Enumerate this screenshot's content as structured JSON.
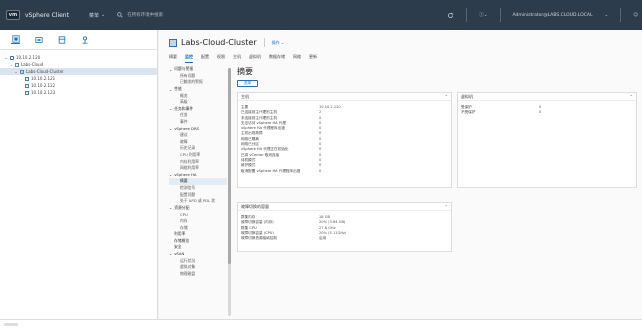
{
  "header": {
    "logo_text": "vm",
    "product_name": "vSphere Client",
    "menu_label": "菜单",
    "search_placeholder": "在所有环境中搜索",
    "user_label": "Administrator@LABS.CLOUD.LOCAL"
  },
  "left_panel": {
    "tree": [
      {
        "label": "10.10.2.120",
        "depth": 0,
        "toggle": "⌄",
        "icon": "vcenter-icon"
      },
      {
        "label": "Labs-Cloud",
        "depth": 1,
        "toggle": "⌄",
        "icon": "datacenter-icon"
      },
      {
        "label": "Labs-Cloud-Cluster",
        "depth": 2,
        "toggle": "⌄",
        "icon": "cluster-icon",
        "selected": true
      },
      {
        "label": "10.10.2.121",
        "depth": 3,
        "toggle": "",
        "icon": "host-icon"
      },
      {
        "label": "10.10.2.122",
        "depth": 3,
        "toggle": "",
        "icon": "host-icon"
      },
      {
        "label": "10.10.2.123",
        "depth": 3,
        "toggle": "",
        "icon": "host-icon"
      }
    ]
  },
  "content": {
    "title": "Labs-Cloud-Cluster",
    "actions_label": "操作 ⌄",
    "tabs": [
      "摘要",
      "监控",
      "配置",
      "权限",
      "主机",
      "虚拟机",
      "数据存储",
      "网络",
      "更新"
    ],
    "active_tab": 1
  },
  "subnav": [
    {
      "label": "问题与警报",
      "type": "group"
    },
    {
      "label": "所有问题",
      "type": "child"
    },
    {
      "label": "已触发的警报",
      "type": "child"
    },
    {
      "label": "性能",
      "type": "group"
    },
    {
      "label": "概览",
      "type": "child"
    },
    {
      "label": "高级",
      "type": "child"
    },
    {
      "label": "任务和事件",
      "type": "group"
    },
    {
      "label": "任务",
      "type": "child"
    },
    {
      "label": "事件",
      "type": "child"
    },
    {
      "label": "vSphere DRS",
      "type": "group"
    },
    {
      "label": "建议",
      "type": "child"
    },
    {
      "label": "故障",
      "type": "child"
    },
    {
      "label": "历史记录",
      "type": "child"
    },
    {
      "label": "CPU 利用率",
      "type": "child"
    },
    {
      "label": "内存利用率",
      "type": "child"
    },
    {
      "label": "网络利用率",
      "type": "child"
    },
    {
      "label": "vSphere HA",
      "type": "group"
    },
    {
      "label": "摘要",
      "type": "child",
      "active": true
    },
    {
      "label": "检测信号",
      "type": "child"
    },
    {
      "label": "配置问题",
      "type": "child"
    },
    {
      "label": "处于 APD 或 PDL 状",
      "type": "child"
    },
    {
      "label": "资源分配",
      "type": "group"
    },
    {
      "label": "CPU",
      "type": "child"
    },
    {
      "label": "内存",
      "type": "child"
    },
    {
      "label": "存储",
      "type": "child"
    },
    {
      "label": "利用率",
      "type": "flat"
    },
    {
      "label": "存储概览",
      "type": "flat"
    },
    {
      "label": "安全",
      "type": "flat"
    },
    {
      "label": "vSAN",
      "type": "group"
    },
    {
      "label": "运行状况",
      "type": "child"
    },
    {
      "label": "虚拟对象",
      "type": "child"
    },
    {
      "label": "物理磁盘",
      "type": "child"
    }
  ],
  "main": {
    "page_title": "摘要",
    "new_button": "选择",
    "hosts_card": {
      "title": "主机",
      "rows": [
        {
          "k": "主要",
          "v": "10.10.2.120"
        },
        {
          "k": "已连接到主代理的主机",
          "v": "2"
        },
        {
          "k": "未连接到主代理的主机",
          "v": "0"
        },
        {
          "k": "无法访问 vSphere HA 代理",
          "v": "0"
        },
        {
          "k": "vSphere HA 代理程序出错",
          "v": "0"
        },
        {
          "k": "主机出现故障",
          "v": "0"
        },
        {
          "k": "网络已隔离",
          "v": "0"
        },
        {
          "k": "网络已分区",
          "v": "0"
        },
        {
          "k": "vSphere HA 代理正在初始化",
          "v": "0"
        },
        {
          "k": "已将 vCenter 取消连接",
          "v": "0"
        },
        {
          "k": "待机模式",
          "v": "0"
        },
        {
          "k": "维护模式",
          "v": "0"
        },
        {
          "k": "取消配置 vSphere HA 代理程序出错",
          "v": "0"
        }
      ]
    },
    "vms_card": {
      "title": "虚拟机",
      "rows": [
        {
          "k": "受保护",
          "v": "0"
        },
        {
          "k": "不受保护",
          "v": "0"
        }
      ]
    },
    "reserve_card": {
      "title": "故障切换的容量",
      "rows": [
        {
          "k": "群集内存",
          "v": "18 GB"
        },
        {
          "k": "故障切换容量 (内存)",
          "v": "20% (3.64 GB)"
        },
        {
          "k": "群集 CPU",
          "v": "27.6 GHz"
        },
        {
          "k": "故障切换容量 (CPU)",
          "v": "20% (5.11GHz)"
        },
        {
          "k": "故障切换资源接纳控制",
          "v": "启用"
        }
      ]
    }
  }
}
